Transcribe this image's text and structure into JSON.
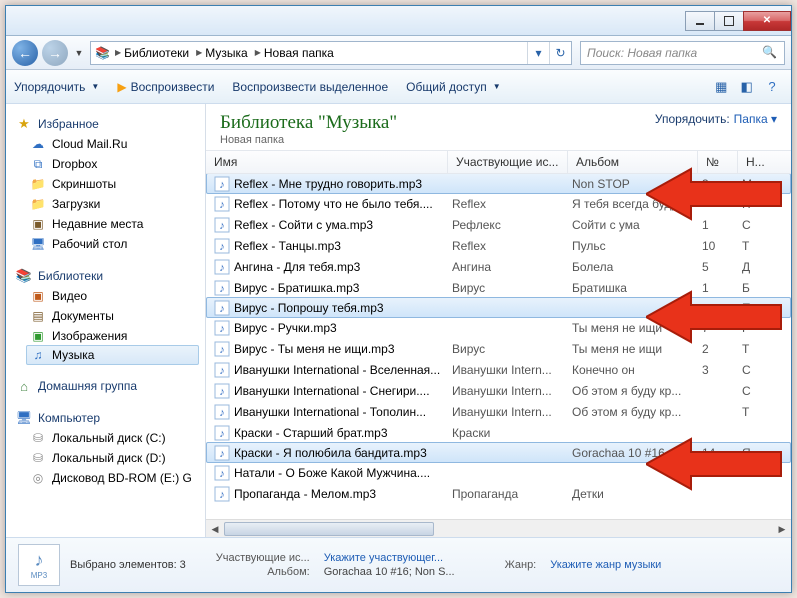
{
  "breadcrumb": {
    "seg1": "Библиотеки",
    "seg2": "Музыка",
    "seg3": "Новая папка"
  },
  "search": {
    "placeholder": "Поиск: Новая папка"
  },
  "toolbar": {
    "organize": "Упорядочить",
    "play": "Воспроизвести",
    "playsel": "Воспроизвести выделенное",
    "share": "Общий доступ"
  },
  "sidebar": {
    "favorites": "Избранное",
    "cloud": "Cloud Mail.Ru",
    "dropbox": "Dropbox",
    "screens": "Скриншоты",
    "downloads": "Загрузки",
    "recent": "Недавние места",
    "desktop": "Рабочий стол",
    "libraries": "Библиотеки",
    "video": "Видео",
    "docs": "Документы",
    "images": "Изображения",
    "music": "Музыка",
    "homegroup": "Домашняя группа",
    "computer": "Компьютер",
    "diskc": "Локальный диск (C:)",
    "diskd": "Локальный диск (D:)",
    "bd": "Дисковод BD-ROM (E:) G"
  },
  "libheader": {
    "title": "Библиотека \"Музыка\"",
    "subtitle": "Новая папка",
    "sort_label": "Упорядочить:",
    "sort_value": "Папка"
  },
  "columns": {
    "name": "Имя",
    "artists": "Участвующие ис...",
    "album": "Альбом",
    "track": "№",
    "n": "Н..."
  },
  "files": [
    {
      "name": "Reflex - Мне трудно говорить.mp3",
      "artist": "",
      "album": "Non STOP",
      "track": "3",
      "n": "М",
      "sel": true
    },
    {
      "name": "Reflex - Потому что не было тебя....",
      "artist": "Reflex",
      "album": "Я тебя всегда буду ...",
      "track": "",
      "n": "П"
    },
    {
      "name": "Reflex - Сойти с ума.mp3",
      "artist": "Рефлекс",
      "album": "Сойти с ума",
      "track": "1",
      "n": "С"
    },
    {
      "name": "Reflex - Танцы.mp3",
      "artist": "Reflex",
      "album": "Пульс",
      "track": "10",
      "n": "Т"
    },
    {
      "name": "Ангина - Для тебя.mp3",
      "artist": "Ангина",
      "album": "Болела",
      "track": "5",
      "n": "Д"
    },
    {
      "name": "Вирус - Братишка.mp3",
      "artist": "Вирус",
      "album": "Братишка",
      "track": "1",
      "n": "Б"
    },
    {
      "name": "Вирус - Попрошу тебя.mp3",
      "artist": "",
      "album": "",
      "track": "",
      "n": "П",
      "sel": true
    },
    {
      "name": "Вирус - Ручки.mp3",
      "artist": "",
      "album": "Ты меня не ищи",
      "track": "7",
      "n": "Р"
    },
    {
      "name": "Вирус - Ты меня не ищи.mp3",
      "artist": "Вирус",
      "album": "Ты меня не ищи",
      "track": "2",
      "n": "Т"
    },
    {
      "name": "Иванушки International - Вселенная...",
      "artist": "Иванушки Intern...",
      "album": "Конечно он",
      "track": "3",
      "n": "С"
    },
    {
      "name": "Иванушки International - Снегири....",
      "artist": "Иванушки Intern...",
      "album": "Об этом я буду кр...",
      "track": "",
      "n": "С"
    },
    {
      "name": "Иванушки International - Тополин...",
      "artist": "Иванушки Intern...",
      "album": "Об этом я буду кр...",
      "track": "",
      "n": "Т"
    },
    {
      "name": "Краски - Старший брат.mp3",
      "artist": "Краски",
      "album": "",
      "track": "",
      "n": ""
    },
    {
      "name": "Краски - Я полюбила бандита.mp3",
      "artist": "",
      "album": "Gorachaa 10 #16",
      "track": "14",
      "n": "Я",
      "sel": true
    },
    {
      "name": "Натали - О Боже Какой Мужчина....",
      "artist": "",
      "album": "",
      "track": "",
      "n": ""
    },
    {
      "name": "Пропаганда - Мелом.mp3",
      "artist": "Пропаганда",
      "album": "Детки",
      "track": "",
      "n": ""
    }
  ],
  "details": {
    "selcount": "Выбрано элементов: 3",
    "mp3": "MP3",
    "artists_lbl": "Участвующие ис...",
    "artists_val": "Укажите участвующег...",
    "album_lbl": "Альбом:",
    "album_val": "Gorachaa 10 #16; Non S...",
    "genre_lbl": "Жанр:",
    "genre_val": "Укажите жанр музыки"
  }
}
